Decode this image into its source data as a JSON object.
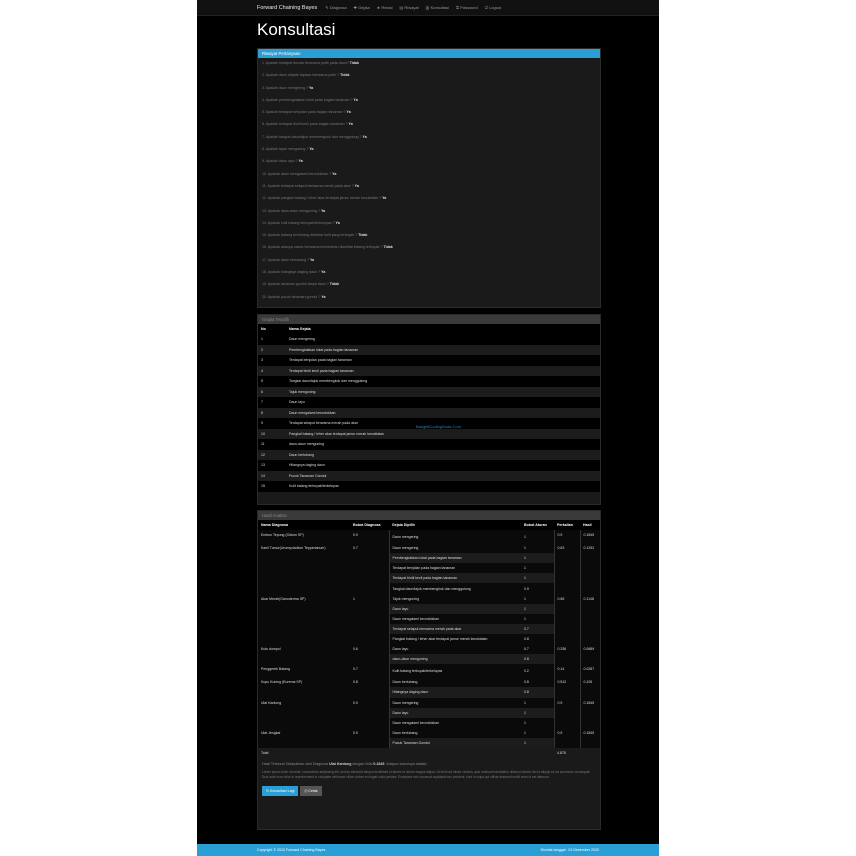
{
  "nav": {
    "brand": "Forward Chaining Bayes",
    "items": [
      {
        "icon": "✎",
        "label": "Diagnosa"
      },
      {
        "icon": "✚",
        "label": "Gejala"
      },
      {
        "icon": "★",
        "label": "Relasi"
      },
      {
        "icon": "▤",
        "label": "Riwayat"
      },
      {
        "icon": "▥",
        "label": "Konsultasi"
      },
      {
        "icon": "⚿",
        "label": "Password"
      },
      {
        "icon": "⏻",
        "label": "Logout"
      }
    ]
  },
  "page_title": "Konsultasi",
  "riwayat": {
    "heading": "Riwayat Pertanyaan",
    "questions": [
      {
        "q": "1. Apakah terdapat bercak berwarna putih pada daun? ",
        "a": "Tidak"
      },
      {
        "q": "2. Apakah daun dilapisi lapisan berwarna putih ? ",
        "a": "Tidak"
      },
      {
        "q": "3. Apakah daun mengering ? ",
        "a": "Ya"
      },
      {
        "q": "4. Apakah pembengkakkan lokal pada bagian tanaman ? ",
        "a": "Ya"
      },
      {
        "q": "5. Apakah terdapat benjolan pada bagian tanaman ? ",
        "a": "Ya"
      },
      {
        "q": "6. Apakah terdapat bintil kecil pada bagian tanaman ? ",
        "a": "Ya"
      },
      {
        "q": "7. Apakah tangkai daun/tajuk membengkok dan menggulung ? ",
        "a": "Ya"
      },
      {
        "q": "8. Apakah tajuk menguning ? ",
        "a": "Ya"
      },
      {
        "q": "9. Apakah daun layu ? ",
        "a": "Ya"
      },
      {
        "q": "10. Apakah daun mengalami kerontokkan ? ",
        "a": "Ya"
      },
      {
        "q": "11. Apakah terdapat selaput berwarna merah pada akar ? ",
        "a": "Ya"
      },
      {
        "q": "12. Apakah pangkal batang / leher akar terdapat jamur merah kecoklatan ? ",
        "a": "Ya"
      },
      {
        "q": "13. Apakah daun-daun menguning ? ",
        "a": "Ya"
      },
      {
        "q": "14. Apakah kulit batang terkoyak/terkelupas ? ",
        "a": "Ya"
      },
      {
        "q": "15. Apakah batang berlubang disekitar kulit yang terkoyak ? ",
        "a": "Tidak"
      },
      {
        "q": "16. Apakah adanya cairan berwarna kemerahan disekitar batang terkoyak ? ",
        "a": "Tidak"
      },
      {
        "q": "17. Apakah daun berlubang ? ",
        "a": "Ya"
      },
      {
        "q": "18. Apakah hilangnya daging daun ? ",
        "a": "Ya"
      },
      {
        "q": "19. Apakah tanaman gundul tanpa daun ? ",
        "a": "Tidak"
      },
      {
        "q": "20. Apakah pucuk tanaman gundul ? ",
        "a": "Ya"
      }
    ]
  },
  "gejala": {
    "heading": "Gejala Terpilih",
    "columns": [
      "No",
      "Nama Gejala"
    ],
    "rows": [
      [
        "1",
        "Daun mengering"
      ],
      [
        "2",
        "Pembengkakkan lokal pada bagian tanaman"
      ],
      [
        "3",
        "Terdapat benjolan pada bagian tanaman"
      ],
      [
        "4",
        "Terdapat bintil kecil pada bagian tanaman"
      ],
      [
        "5",
        "Tangkai daun/tajuk membengkok dan menggulung"
      ],
      [
        "6",
        "Tajuk menguning"
      ],
      [
        "7",
        "Daun layu"
      ],
      [
        "8",
        "Daun mengalami kerontokkan"
      ],
      [
        "9",
        "Terdapat selaput berwarna merah pada akar"
      ],
      [
        "10",
        "Pangkal batang / leher akar terdapat jamur merah kecoklatan"
      ],
      [
        "11",
        "daun-daun menguning"
      ],
      [
        "12",
        "Daun berlubang"
      ],
      [
        "13",
        "Hilangnya daging daun"
      ],
      [
        "14",
        "Pucuk Tanaman Gundul"
      ],
      [
        "15",
        "Kulit batang terkoyak/terkelupas"
      ]
    ]
  },
  "hasil": {
    "heading": "Hasil Analisa",
    "columns": [
      "Nama Diagnosa",
      "Bobot Diagnosa",
      "Gejala Dipilih",
      "Bobot Aturan",
      "Perkalian",
      "Hasil"
    ],
    "groups": [
      {
        "name": "Embun Tepung (Odium SP)",
        "bobot": "0.9",
        "perkalian": "0.9",
        "hasil": "0.1845",
        "gejala": [
          [
            "Daun mengering",
            "1"
          ]
        ]
      },
      {
        "name": "Kanil Tumor(Uromycladium Tepperianum)",
        "bobot": "0.7",
        "perkalian": "0.63",
        "hasil": "0.1292",
        "gejala": [
          [
            "Daun mengering",
            "1"
          ],
          [
            "Pembengkakkan lokal pada bagian tanaman",
            "1"
          ],
          [
            "Terdapat benjolan pada bagian tanaman",
            "1"
          ],
          [
            "Terdapat bintil kecil pada bagian tanaman",
            "1"
          ],
          [
            "Tangkai daun/tajuk membengkok dan menggulung",
            "0.9"
          ]
        ]
      },
      {
        "name": "Akar Merah(Ganoderma SP)",
        "bobot": "1",
        "perkalian": "0.56",
        "hasil": "0.1148",
        "gejala": [
          [
            "Tajuk menguning",
            "1"
          ],
          [
            "Daun layu",
            "1"
          ],
          [
            "Daun mengalami kerontokkan",
            "1"
          ],
          [
            "Terdapat selaput berwarna merah pada akar",
            "0.7"
          ],
          [
            "Pangkal batang / leher akar terdapat jamur merah kecoklatan",
            "0.8"
          ]
        ]
      },
      {
        "name": "Kutu dompol",
        "bobot": "0.6",
        "perkalian": "0.336",
        "hasil": "0.0689",
        "gejala": [
          [
            "Daun layu",
            "0.7"
          ],
          [
            "daun-daun menguning",
            "0.8"
          ]
        ]
      },
      {
        "name": "Penggerek Batang",
        "bobot": "0.7",
        "perkalian": "0.14",
        "hasil": "0.0287",
        "gejala": [
          [
            "Kulit batang terkoyak/terkelupas",
            "0.2"
          ]
        ]
      },
      {
        "name": "Kupu Kuning (Eurema SP)",
        "bobot": "0.8",
        "perkalian": "0.512",
        "hasil": "0.105",
        "gejala": [
          [
            "Daun berlubang",
            "0.8"
          ],
          [
            "Hilangnya daging daun",
            "0.8"
          ]
        ]
      },
      {
        "name": "Ulat Kantong",
        "bobot": "0.9",
        "perkalian": "0.9",
        "hasil": "0.1845",
        "gejala": [
          [
            "Daun mengering",
            "1"
          ],
          [
            "Daun layu",
            "1"
          ],
          [
            "Daun mengalami kerontokkan",
            "1"
          ]
        ]
      },
      {
        "name": "Ulat Jengkal",
        "bobot": "0.9",
        "perkalian": "0.9",
        "hasil": "0.1845",
        "gejala": [
          [
            "Daun berlubang",
            "1"
          ],
          [
            "Pucuk Tanaman Gundul",
            "1"
          ]
        ]
      }
    ],
    "total_label": "Total",
    "total_value": "4.878",
    "conclusion_prefix": "Hasil Terbesar Didapatkan oleh Diagnosa ",
    "conclusion_name": "Ulat Kantong",
    "conclusion_mid": " dengan Nilai ",
    "conclusion_value": "0.1845",
    "conclusion_suffix": ". Adapun solusinya adalah:",
    "solution": "Lorem ipsum dolor sit amet, consectetur adipiscing elit, sed do eiusmod tempor incididunt ut labore et dolore magna aliqua. Ut enim ad minim veniam, quis nostrud exercitation ullamco laboris nisi ut aliquip ex ea commodo consequat. Duis aute irure dolor in reprehenderit in voluptate velit esse cillum dolore eu fugiat nulla pariatur. Excepteur sint occaecat cupidatat non proident, sunt in culpa qui officia deserunt mollit anim id est laborum.",
    "btn_again": "Konsultasi Lagi",
    "btn_print": "Cetak"
  },
  "watermark": "BangkitCodingSoda.Com",
  "footer": {
    "left": "Copyright © 2020 Forward Chaining Bayes",
    "right": "Dicetak tanggal : 01 Desember 2020"
  },
  "colors": {
    "accent": "#2a9fd6",
    "background": "#000000",
    "panel": "#1a1a1a"
  }
}
